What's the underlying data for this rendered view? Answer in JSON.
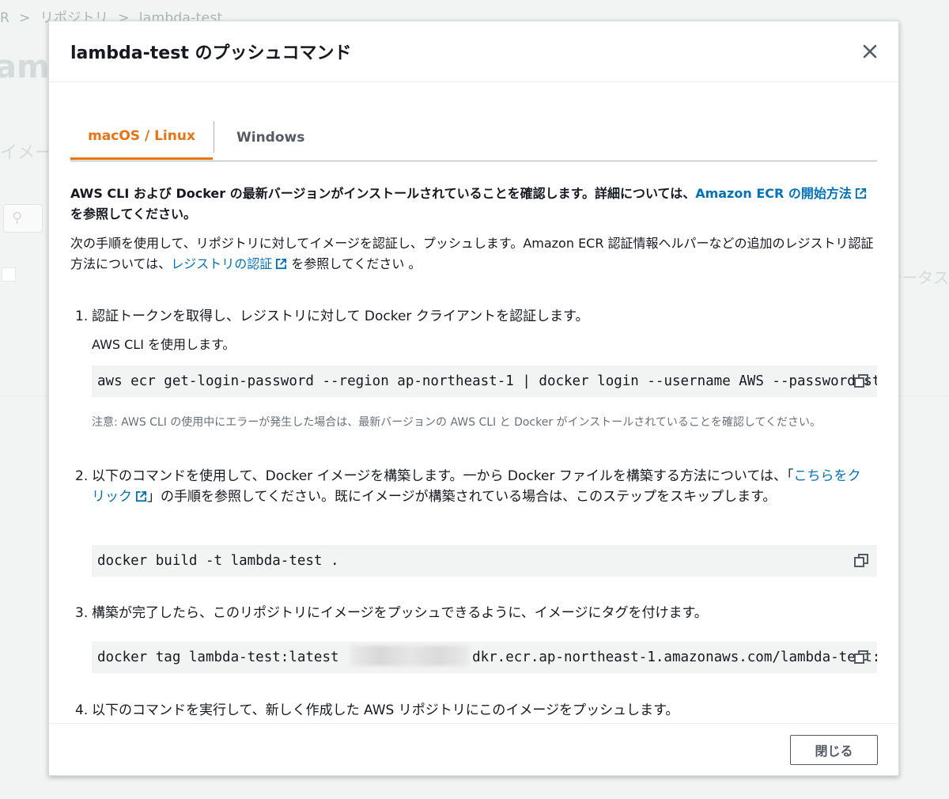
{
  "background": {
    "breadcrumb": [
      "R",
      "リポジトリ",
      "lambda-test"
    ],
    "title": "amb",
    "section": "イメー",
    "column": "テータス"
  },
  "modal": {
    "title": "lambda-test のプッシュコマンド",
    "tabs": [
      {
        "label": "macOS / Linux",
        "active": true
      },
      {
        "label": "Windows",
        "active": false
      }
    ],
    "intro": {
      "text_before": "AWS CLI および Docker の最新バージョンがインストールされていることを確認します。詳細については、",
      "link": "Amazon ECR の開始方法",
      "text_after": " を参照してください。"
    },
    "para": {
      "text_before": "次の手順を使用して、リポジトリに対してイメージを認証し、プッシュします。Amazon ECR 認証情報ヘルパーなどの追加のレジストリ認証方法については、",
      "link": "レジストリの認証",
      "text_after": " を参照してください 。"
    },
    "steps": [
      {
        "number": "1.",
        "text": "認証トークンを取得し、レジストリに対して Docker クライアントを認証します。",
        "sub": "AWS CLI を使用します。",
        "command": "aws ecr get-login-password --region ap-northeast-1 | docker login --username AWS --password-stdin",
        "note": "注意: AWS CLI の使用中にエラーが発生した場合は、最新バージョンの AWS CLI と Docker がインストールされていることを確認してください。"
      },
      {
        "number": "2.",
        "text_before": "以下のコマンドを使用して、Docker イメージを構築します。一から Docker ファイルを構築する方法については、「",
        "link": "こちらをクリック",
        "text_after": "」の手順を参照してください。既にイメージが構築されている場合は、このステップをスキップします。",
        "command": "docker build -t lambda-test ."
      },
      {
        "number": "3.",
        "text": "構築が完了したら、このリポジトリにイメージをプッシュできるように、イメージにタグを付けます。",
        "command_before": "docker tag lambda-test:latest ",
        "command_after": "dkr.ecr.ap-northeast-1.amazonaws.com/lambda-test:latest"
      },
      {
        "number": "4.",
        "text": "以下のコマンドを実行して、新しく作成した AWS リポジトリにこのイメージをプッシュします。"
      }
    ],
    "footer": {
      "close_label": "閉じる"
    }
  },
  "colors": {
    "accent": "#ec7211",
    "link": "#0073bb",
    "code_bg": "#f2f3f3"
  }
}
